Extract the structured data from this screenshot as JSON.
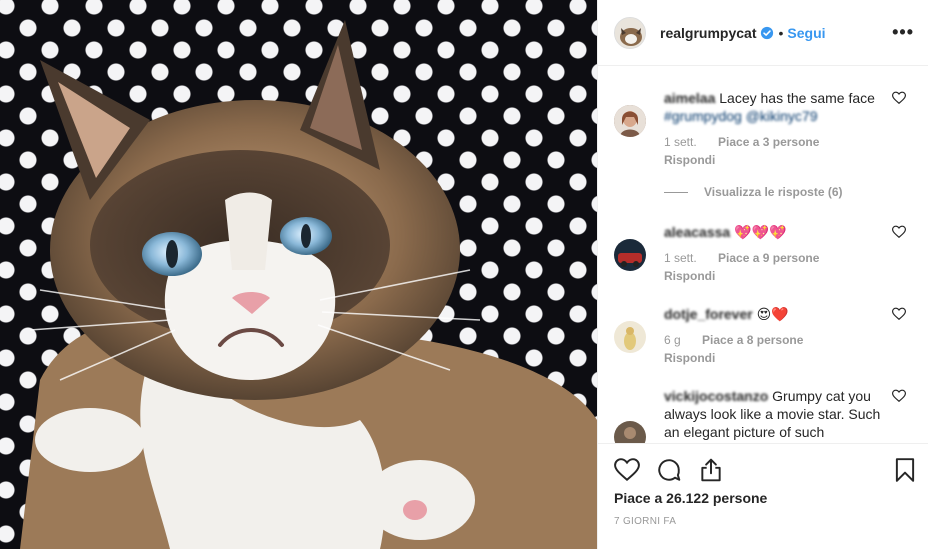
{
  "post": {
    "image_alt": "Grumpy cat on polka dot background",
    "author": {
      "username": "realgrumpycat",
      "verified": true,
      "follow_label": "Segui",
      "separator": "•"
    },
    "more_label": "•••"
  },
  "comments": [
    {
      "username": "aimelaa",
      "text": "Lacey has the same face",
      "tags": "#grumpydog @kikinyc79",
      "time": "1 sett.",
      "likes": "Piace a 3 persone",
      "reply_label": "Rispondi",
      "avatar_color": "#8a6f5e"
    },
    {
      "username": "aleacassa",
      "text": "💖💖💖",
      "time": "1 sett.",
      "likes": "Piace a 9 persone",
      "reply_label": "Rispondi",
      "avatar_color": "#b52d2a"
    },
    {
      "username": "dotje_forever",
      "text": "😍❤️",
      "time": "6 g",
      "likes": "Piace a 8 persone",
      "reply_label": "Rispondi",
      "avatar_color": "#e7dcc0"
    },
    {
      "username": "vickijocostanzo",
      "text": "Grumpy cat you always look like a movie star. Such an elegant picture of such",
      "avatar_color": "#6b5a4a"
    }
  ],
  "view_replies": "Visualizza le risposte (6)",
  "actions": {
    "like_icon": "heart-outline-icon",
    "comment_icon": "comment-bubble-icon",
    "share_icon": "share-icon",
    "save_icon": "bookmark-icon"
  },
  "like_summary": {
    "prefix": "Piace a",
    "count": "26.122",
    "suffix": "persone"
  },
  "posted": "7 giorni fa",
  "colors": {
    "accent": "#3897f0",
    "text": "#262626",
    "muted": "#999999",
    "verified": "#3897f0"
  }
}
